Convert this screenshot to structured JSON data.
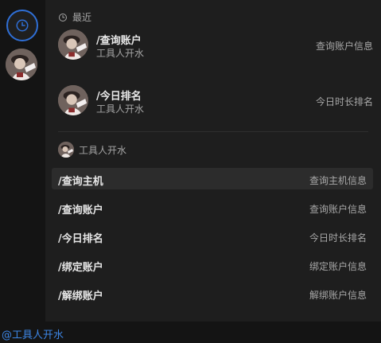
{
  "rail": {
    "items": [
      {
        "icon": "clock-icon",
        "active": true
      },
      {
        "icon": "bot-avatar"
      }
    ]
  },
  "recent": {
    "header": "最近",
    "items": [
      {
        "command": "/查询账户",
        "bot": "工具人开水",
        "description": "查询账户信息"
      },
      {
        "command": "/今日排名",
        "bot": "工具人开水",
        "description": "今日时长排名"
      }
    ]
  },
  "bot_section": {
    "header": "工具人开水",
    "commands": [
      {
        "command": "/查询主机",
        "description": "查询主机信息",
        "active": true
      },
      {
        "command": "/查询账户",
        "description": "查询账户信息"
      },
      {
        "command": "/今日排名",
        "description": "今日时长排名"
      },
      {
        "command": "/绑定账户",
        "description": "绑定账户信息"
      },
      {
        "command": "/解绑账户",
        "description": "解绑账户信息"
      }
    ]
  },
  "input": {
    "value": "@工具人开水"
  },
  "colors": {
    "accent": "#2f6fd6",
    "mention": "#3d86e6",
    "background": "#1e1e1e",
    "rail": "#141414"
  }
}
